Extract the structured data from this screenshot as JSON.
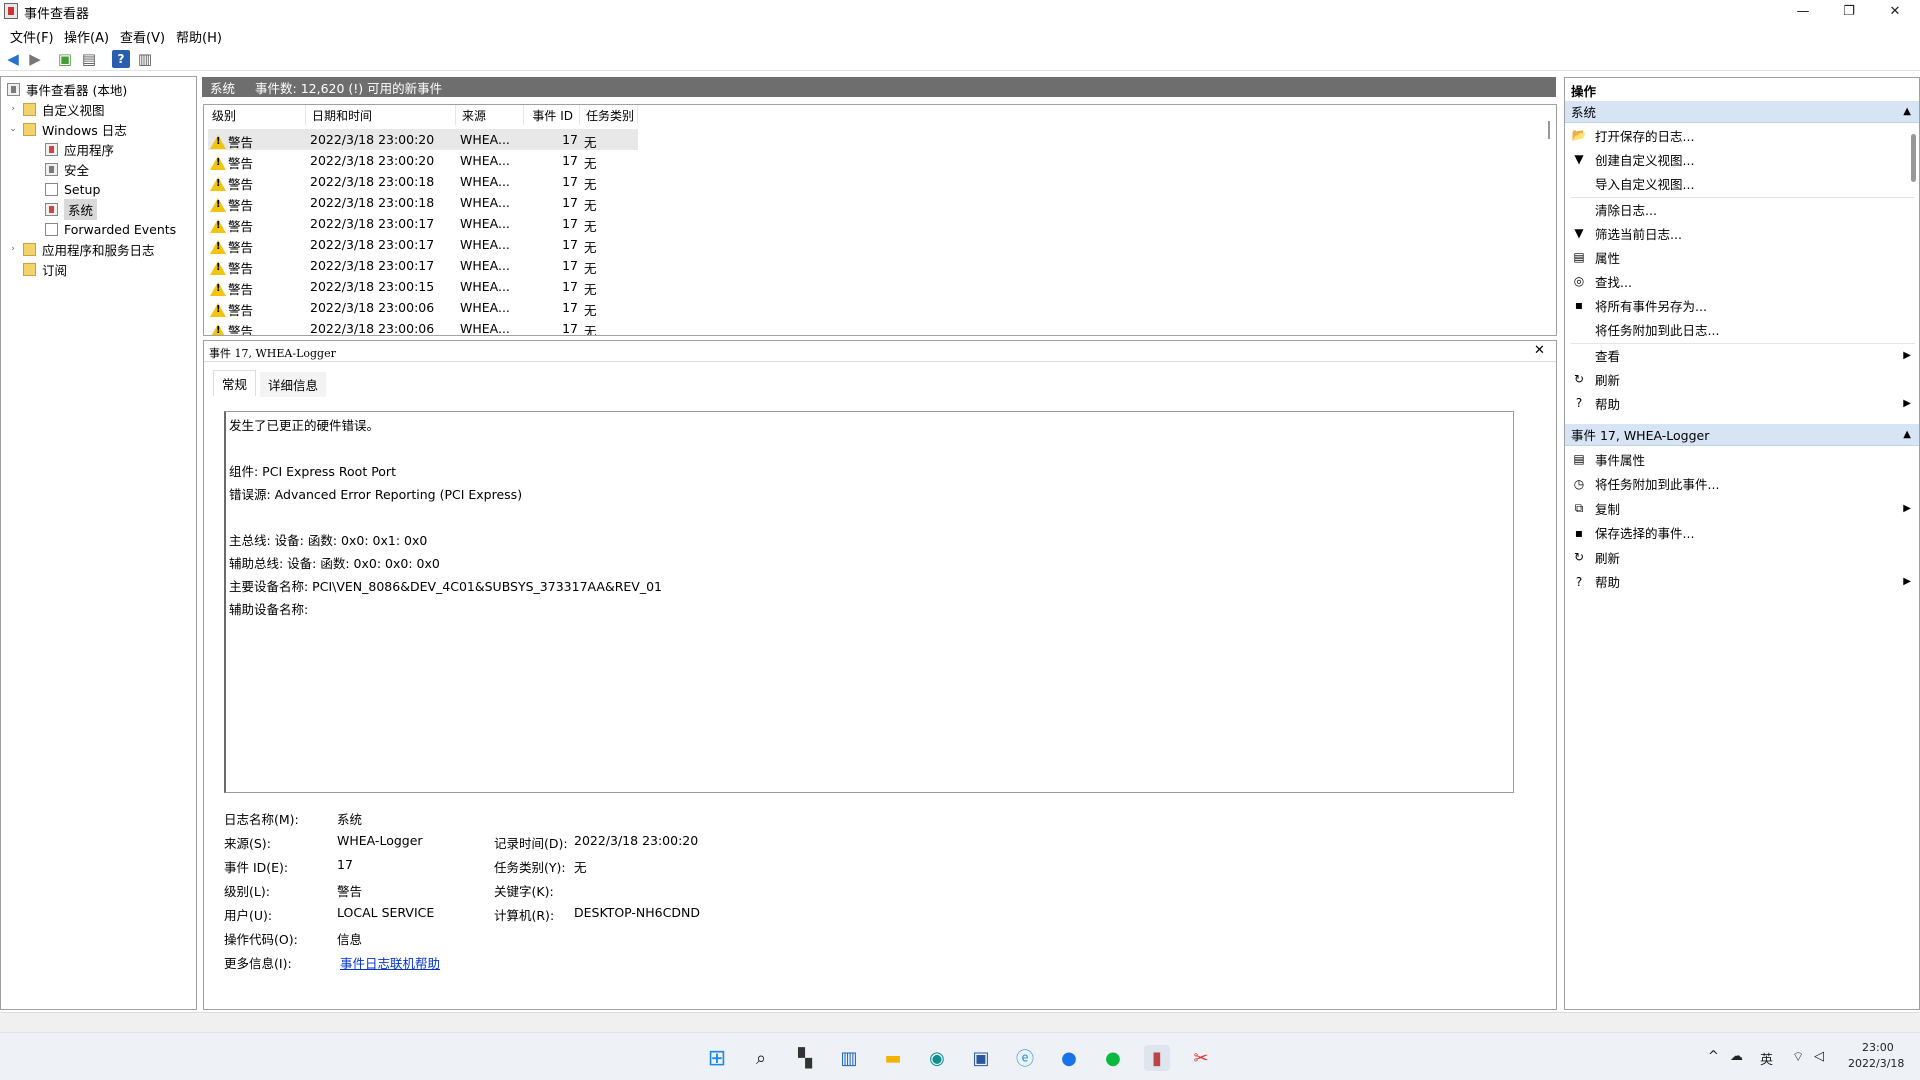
{
  "window": {
    "title": "事件查看器",
    "minimize": "—",
    "maximize": "❐",
    "close": "✕"
  },
  "menu": [
    {
      "label": "文件(F)"
    },
    {
      "label": "操作(A)"
    },
    {
      "label": "查看(V)"
    },
    {
      "label": "帮助(H)"
    }
  ],
  "tree": {
    "root": "事件查看器 (本地)",
    "custom_views": "自定义视图",
    "windows_logs": "Windows 日志",
    "logs": [
      "应用程序",
      "安全",
      "Setup",
      "系统",
      "Forwarded Events"
    ],
    "app_service_logs": "应用程序和服务日志",
    "subscriptions": "订阅"
  },
  "main_header": {
    "title": "系统",
    "summary": "事件数: 12,620 (!) 可用的新事件"
  },
  "grid": {
    "columns": [
      "级别",
      "日期和时间",
      "来源",
      "事件 ID",
      "任务类别"
    ],
    "rows": [
      {
        "level": "警告",
        "time": "2022/3/18 23:00:20",
        "source": "WHEA...",
        "id": "17",
        "task": "无"
      },
      {
        "level": "警告",
        "time": "2022/3/18 23:00:20",
        "source": "WHEA...",
        "id": "17",
        "task": "无"
      },
      {
        "level": "警告",
        "time": "2022/3/18 23:00:18",
        "source": "WHEA...",
        "id": "17",
        "task": "无"
      },
      {
        "level": "警告",
        "time": "2022/3/18 23:00:18",
        "source": "WHEA...",
        "id": "17",
        "task": "无"
      },
      {
        "level": "警告",
        "time": "2022/3/18 23:00:17",
        "source": "WHEA...",
        "id": "17",
        "task": "无"
      },
      {
        "level": "警告",
        "time": "2022/3/18 23:00:17",
        "source": "WHEA...",
        "id": "17",
        "task": "无"
      },
      {
        "level": "警告",
        "time": "2022/3/18 23:00:17",
        "source": "WHEA...",
        "id": "17",
        "task": "无"
      },
      {
        "level": "警告",
        "time": "2022/3/18 23:00:15",
        "source": "WHEA...",
        "id": "17",
        "task": "无"
      },
      {
        "level": "警告",
        "time": "2022/3/18 23:00:06",
        "source": "WHEA...",
        "id": "17",
        "task": "无"
      },
      {
        "level": "警告",
        "time": "2022/3/18 23:00:06",
        "source": "WHEA...",
        "id": "17",
        "task": "无"
      }
    ]
  },
  "detail": {
    "title": "事件 17, WHEA-Logger",
    "close": "✕",
    "tabs": [
      "常规",
      "详细信息"
    ],
    "description": [
      "发生了已更正的硬件错误。",
      "",
      "组件: PCI Express Root Port",
      "错误源: Advanced Error Reporting (PCI Express)",
      "",
      "主总线: 设备: 函数: 0x0: 0x1: 0x0",
      "辅助总线: 设备: 函数: 0x0: 0x0: 0x0",
      "主要设备名称: PCI\\VEN_8086&DEV_4C01&SUBSYS_373317AA&REV_01",
      "辅助设备名称:"
    ],
    "fields": {
      "log_name_label": "日志名称(M):",
      "log_name": "系统",
      "source_label": "来源(S):",
      "source": "WHEA-Logger",
      "logged_label": "记录时间(D):",
      "logged": "2022/3/18 23:00:20",
      "event_id_label": "事件 ID(E):",
      "event_id": "17",
      "task_label": "任务类别(Y):",
      "task": "无",
      "level_label": "级别(L):",
      "level": "警告",
      "keywords_label": "关键字(K):",
      "keywords": "",
      "user_label": "用户(U):",
      "user": "LOCAL SERVICE",
      "computer_label": "计算机(R):",
      "computer": "DESKTOP-NH6CDND",
      "opcode_label": "操作代码(O):",
      "opcode": "信息",
      "more_info_label": "更多信息(I):",
      "more_info_link": "事件日志联机帮助"
    }
  },
  "actions": {
    "header": "操作",
    "section1": "系统",
    "items1": [
      "打开保存的日志...",
      "创建自定义视图...",
      "导入自定义视图...",
      "清除日志...",
      "筛选当前日志...",
      "属性",
      "查找...",
      "将所有事件另存为...",
      "将任务附加到此日志...",
      "查看",
      "刷新",
      "帮助"
    ],
    "section2": "事件 17, WHEA-Logger",
    "items2": [
      "事件属性",
      "将任务附加到此事件...",
      "复制",
      "保存选择的事件...",
      "刷新",
      "帮助"
    ]
  },
  "taskbar": {
    "ime": "英",
    "time": "23:00",
    "date": "2022/3/18"
  },
  "colors": {
    "header_gray": "#6e6e6e",
    "action_section": "#d6e4f3",
    "warning": "#f1c40f",
    "link": "#0033cc"
  }
}
